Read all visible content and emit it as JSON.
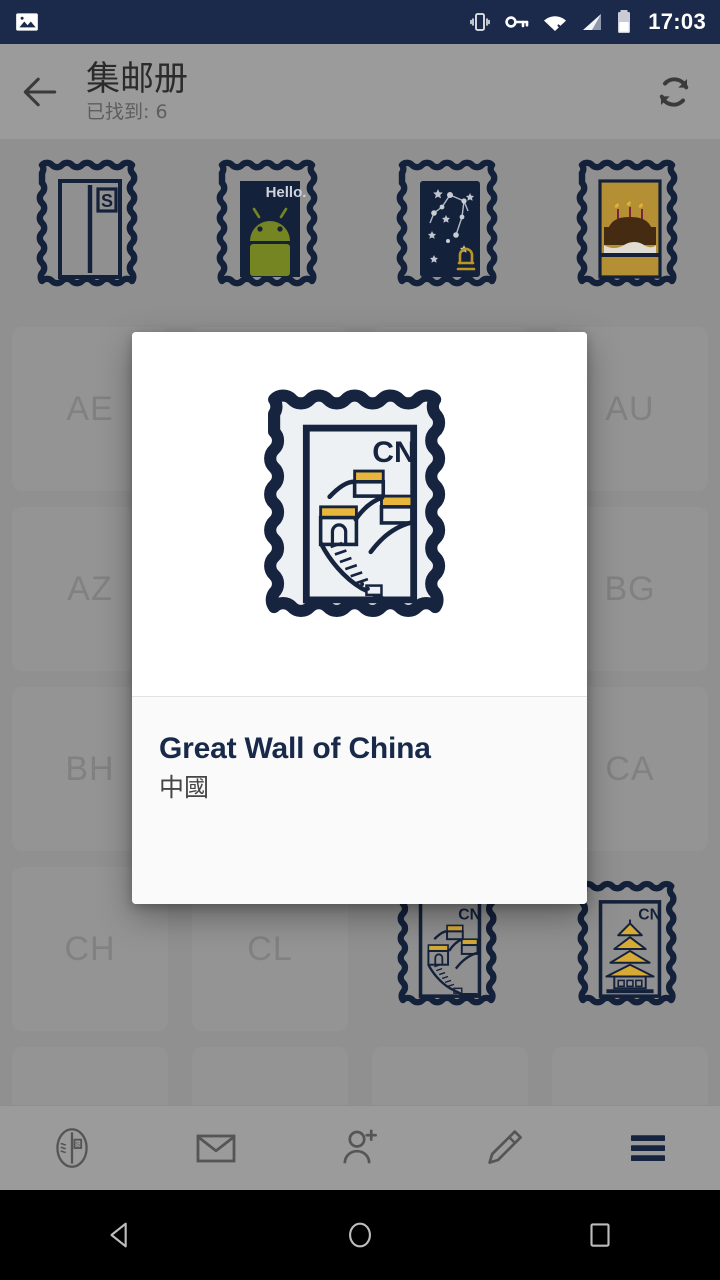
{
  "status_bar": {
    "time": "17:03",
    "icons": [
      "photo-icon",
      "vibrate-icon",
      "vpn-key-icon",
      "wifi-off-icon",
      "cellular-signal-icon",
      "battery-icon"
    ],
    "background_color": "#1b2a4a"
  },
  "app_bar": {
    "back_label": "back-arrow",
    "title": "集邮册",
    "subtitle": "已找到: 6",
    "refresh_label": "refresh",
    "background_color": "#9b9b9b"
  },
  "stamp_row": {
    "items": [
      {
        "name": "letter-s-stamp",
        "code": "S",
        "bg": "#9b9b9b",
        "accent": "#1b2a4a"
      },
      {
        "name": "android-hello-stamp",
        "code": "Hello.",
        "bg": "#16243f",
        "accent": "#7d9025"
      },
      {
        "name": "constellation-libra-stamp",
        "code": "",
        "bg": "#16243f",
        "accent": "#c9a227"
      },
      {
        "name": "birthday-cake-stamp",
        "code": "",
        "bg": "#c39a37",
        "accent": "#4a2f14"
      }
    ]
  },
  "grid": {
    "rows": [
      [
        {
          "type": "code",
          "code": "AE"
        },
        {
          "type": "code",
          "code": ""
        },
        {
          "type": "code",
          "code": ""
        },
        {
          "type": "code",
          "code": "AU"
        }
      ],
      [
        {
          "type": "code",
          "code": "AZ"
        },
        {
          "type": "code",
          "code": ""
        },
        {
          "type": "code",
          "code": ""
        },
        {
          "type": "code",
          "code": "BG"
        }
      ],
      [
        {
          "type": "code",
          "code": "BH"
        },
        {
          "type": "code",
          "code": ""
        },
        {
          "type": "code",
          "code": ""
        },
        {
          "type": "code",
          "code": "CA"
        }
      ],
      [
        {
          "type": "code",
          "code": "CH"
        },
        {
          "type": "code",
          "code": "CL"
        },
        {
          "type": "stamp",
          "variant": "great-wall",
          "code": "CN"
        },
        {
          "type": "stamp",
          "variant": "pagoda",
          "code": "CN"
        }
      ],
      [
        {
          "type": "code",
          "code": ""
        },
        {
          "type": "code",
          "code": ""
        },
        {
          "type": "code",
          "code": ""
        },
        {
          "type": "code",
          "code": ""
        }
      ]
    ]
  },
  "dialog": {
    "title": "Great Wall of China",
    "subtitle": "中國",
    "stamp_code": "CN",
    "stamp_name": "great-wall-stamp",
    "title_color": "#18294a",
    "subtitle_color": "#454545"
  },
  "bottom_nav": {
    "items": [
      {
        "name": "album-icon",
        "label": "album",
        "active": false
      },
      {
        "name": "envelope-icon",
        "label": "mail",
        "active": false
      },
      {
        "name": "add-person-icon",
        "label": "add-contact",
        "active": false
      },
      {
        "name": "pencil-icon",
        "label": "compose",
        "active": false
      },
      {
        "name": "hamburger-menu-icon",
        "label": "menu",
        "active": true
      }
    ],
    "active_color": "#16243f",
    "inactive_color": "#555555"
  },
  "system_nav": {
    "items": [
      "back-triangle",
      "home-circle",
      "recents-square"
    ],
    "background_color": "#000000"
  }
}
